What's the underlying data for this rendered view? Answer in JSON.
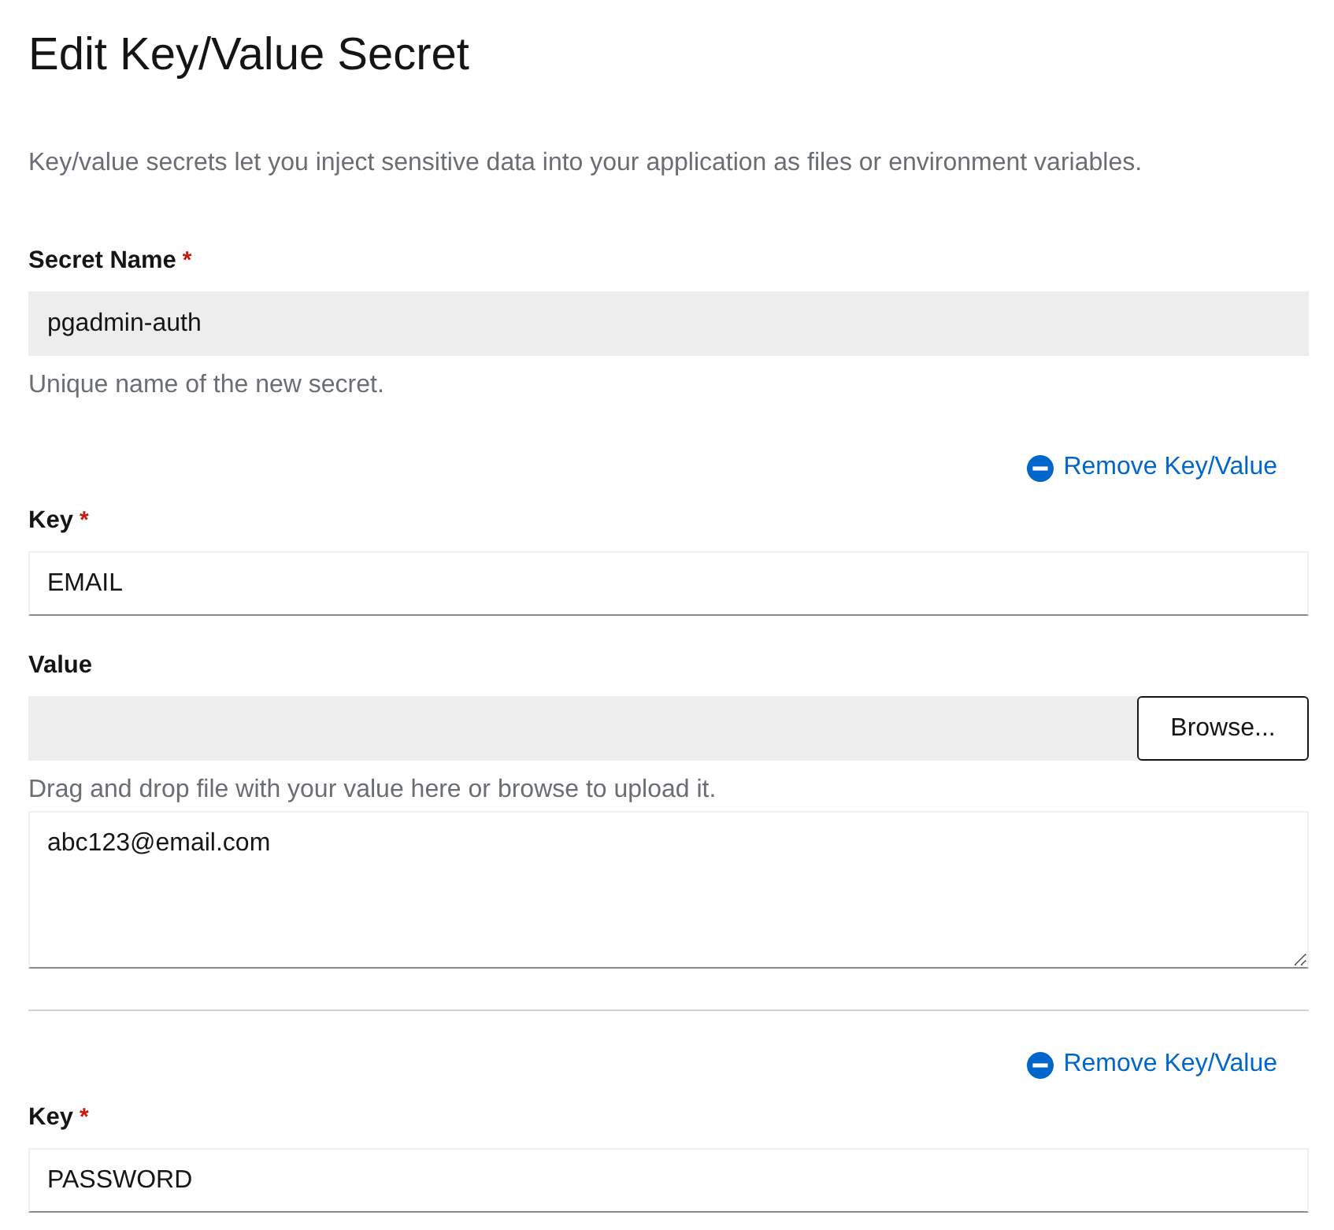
{
  "title": "Edit Key/Value Secret",
  "description": "Key/value secrets let you inject sensitive data into your application as files or environment variables.",
  "secret_name": {
    "label": "Secret Name",
    "required_mark": "*",
    "value": "pgadmin-auth",
    "read_only": true,
    "helper": "Unique name of the new secret."
  },
  "pairs": [
    {
      "remove_link": "Remove Key/Value",
      "key": {
        "label": "Key",
        "required_mark": "*",
        "value": "EMAIL"
      },
      "value": {
        "label": "Value",
        "browse_button": "Browse...",
        "helper": "Drag and drop file with your value here or browse to upload it.",
        "text": "abc123@email.com"
      }
    },
    {
      "remove_link": "Remove Key/Value",
      "key": {
        "label": "Key",
        "required_mark": "*",
        "value": "PASSWORD"
      }
    }
  ]
}
